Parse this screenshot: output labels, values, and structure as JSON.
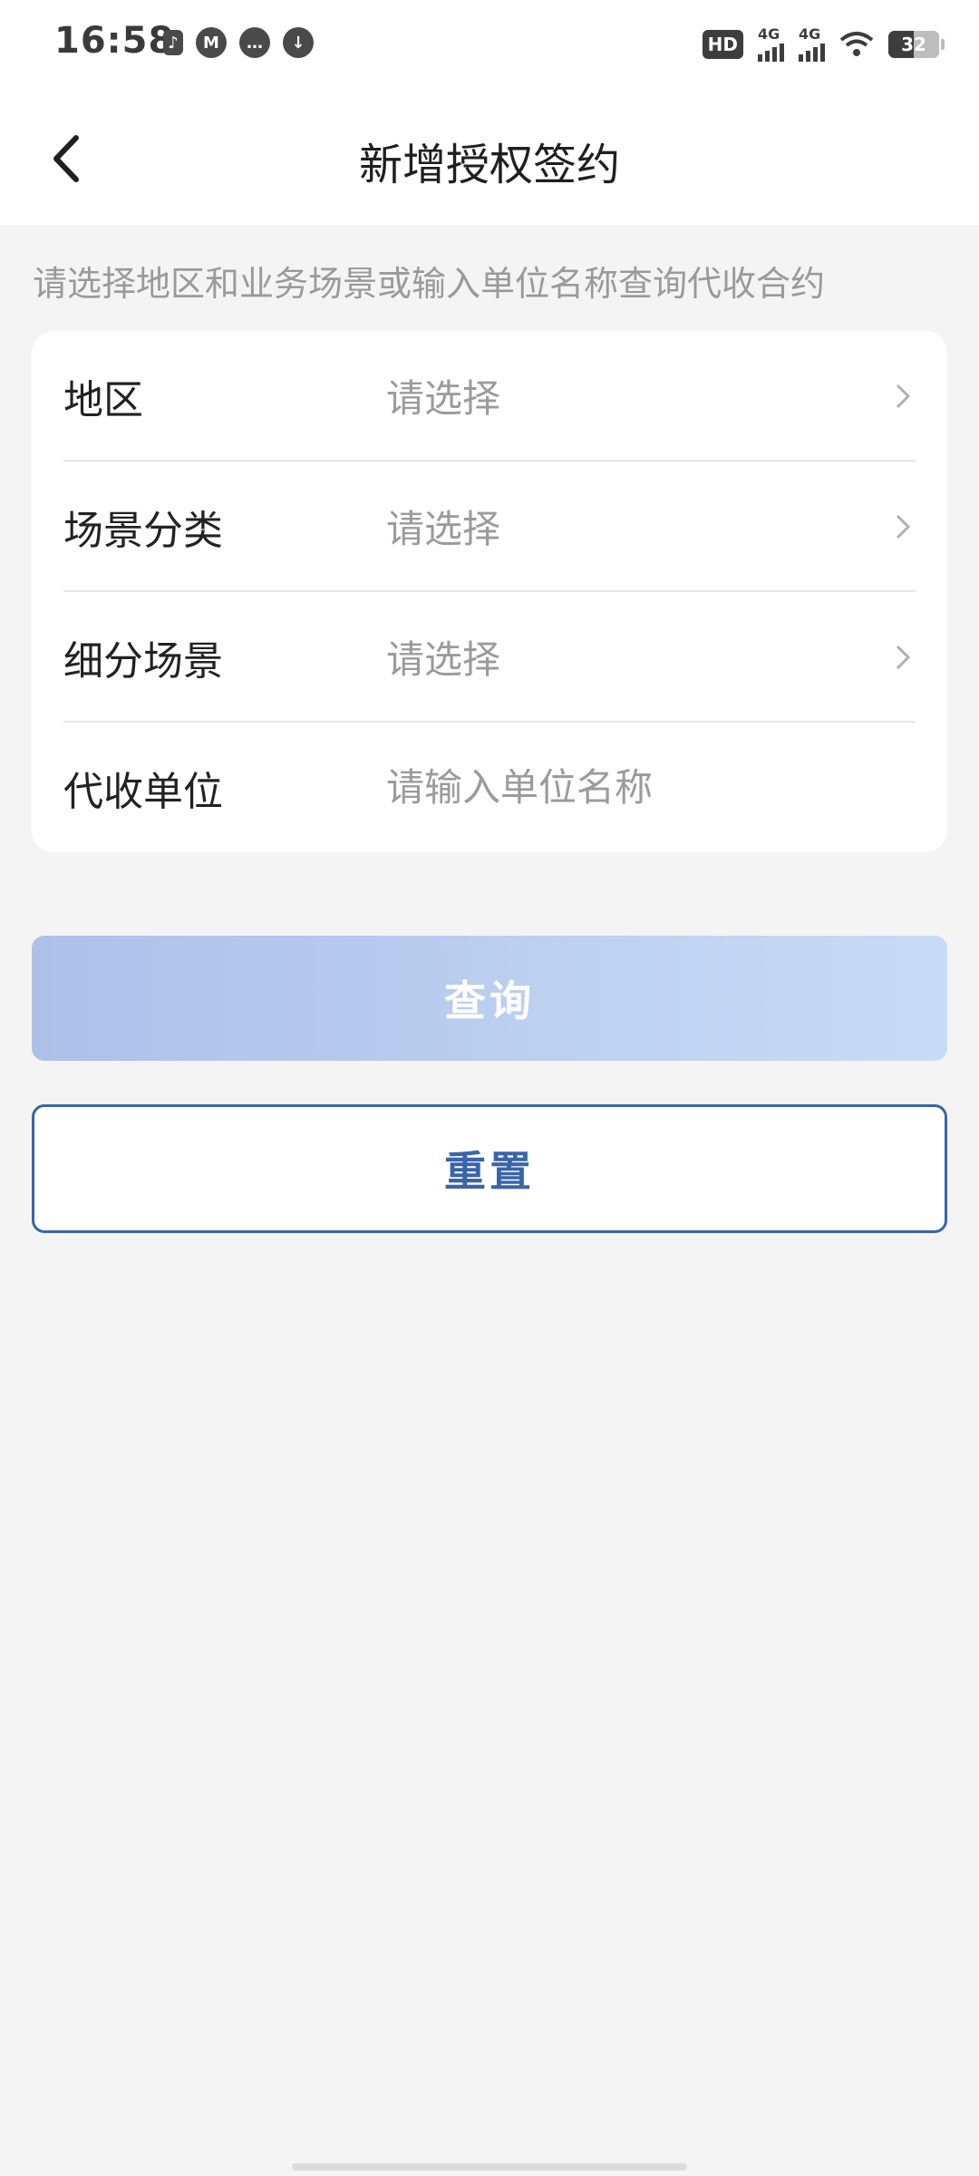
{
  "status_bar": {
    "time": "16:58",
    "hd_label": "HD",
    "signal_1_label": "4G",
    "signal_2_label": "4G",
    "battery_level": "32"
  },
  "header": {
    "title": "新增授权签约"
  },
  "hint_text": "请选择地区和业务场景或输入单位名称查询代收合约",
  "form": {
    "rows": [
      {
        "label": "地区",
        "value": "请选择"
      },
      {
        "label": "场景分类",
        "value": "请选择"
      },
      {
        "label": "细分场景",
        "value": "请选择"
      }
    ],
    "unit_label": "代收单位",
    "unit_placeholder": "请输入单位名称"
  },
  "buttons": {
    "query_label": "查询",
    "reset_label": "重置"
  },
  "colors": {
    "accent": "#3a64aa",
    "query_gradient_start": "#adc0e8",
    "query_gradient_end": "#c8dcf7",
    "background": "#f4f4f4"
  }
}
